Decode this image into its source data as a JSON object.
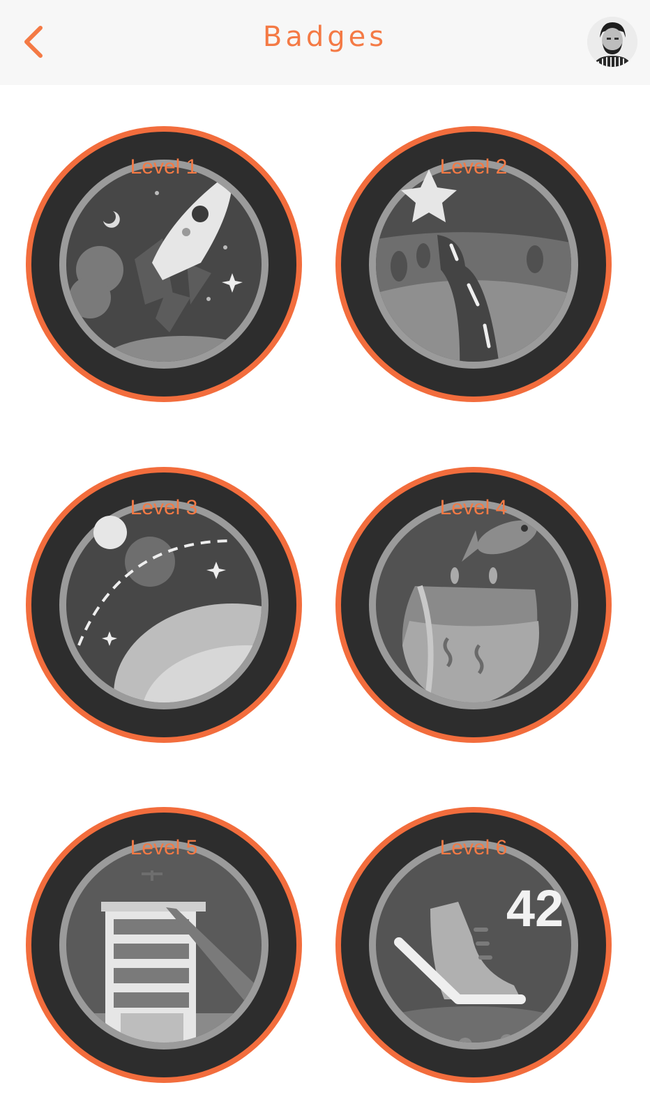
{
  "header": {
    "title": "Badges",
    "back_icon": "chevron-left-icon",
    "accent_color": "#f47a45"
  },
  "badges": [
    {
      "label": "Level 1",
      "icon": "rocket-icon"
    },
    {
      "label": "Level 2",
      "icon": "road-star-icon"
    },
    {
      "label": "Level 3",
      "icon": "planet-orbit-icon"
    },
    {
      "label": "Level 4",
      "icon": "fishbowl-icon"
    },
    {
      "label": "Level 5",
      "icon": "building-icon"
    },
    {
      "label": "Level 6",
      "icon": "shoe-42-icon"
    }
  ],
  "badge6_number": "42",
  "colors": {
    "ring": "#f26d3d",
    "badge_bg": "#2d2d2d",
    "header_bg": "#f7f7f7"
  }
}
